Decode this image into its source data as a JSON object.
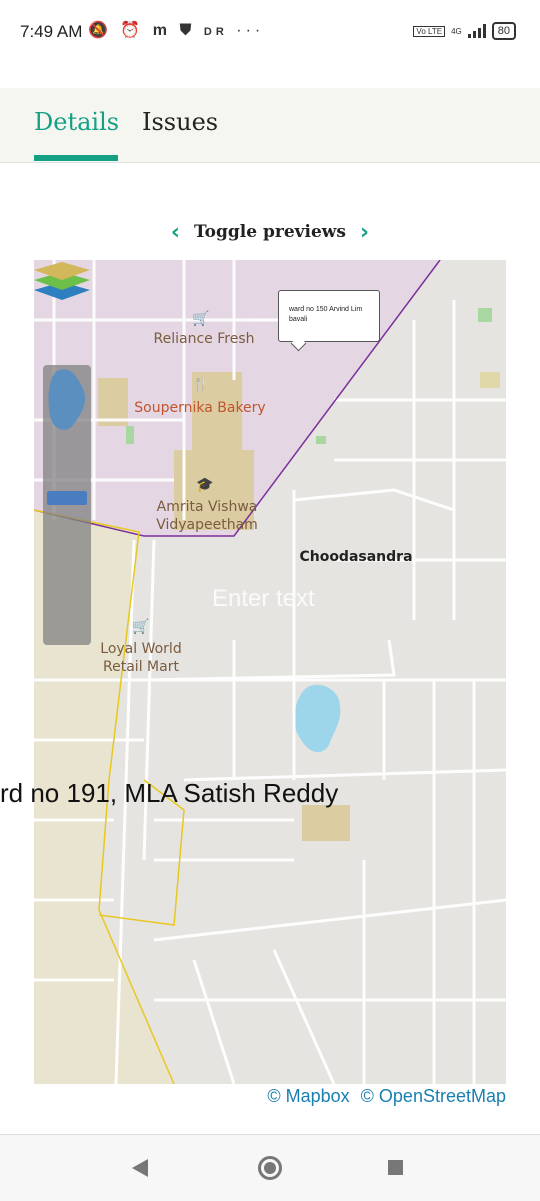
{
  "status_bar": {
    "time": "7:49 AM",
    "icons": [
      "bell-off-icon",
      "alarm-icon",
      "m-app-icon",
      "shield-icon",
      "dr-icon",
      "more-icon"
    ],
    "network": "4G",
    "battery": "80"
  },
  "tabs": [
    {
      "label": "Details",
      "active": true
    },
    {
      "label": "Issues",
      "active": false
    }
  ],
  "toggle": {
    "label": "Toggle previews"
  },
  "map": {
    "labels": {
      "reliance": "Reliance Fresh",
      "soupernika": "Soupernika Bakery",
      "amrita": "Amrita Vishwa Vidyapeetham",
      "choodasandra": "Choodasandra",
      "loyal": "Loyal World Retail Mart"
    },
    "popup_text": "ward no 150 Arvind Lim bavali",
    "enter_text": "Enter text",
    "ward_label": "rd no 191, MLA Satish Reddy",
    "attribution": [
      "© Mapbox",
      "© OpenStreetMap"
    ]
  },
  "colors": {
    "accent": "#13a085",
    "link": "#1a7fb0",
    "ward_purple": "#7a2f9b",
    "ward_yellow": "#e8c820"
  },
  "nav": [
    "back",
    "home",
    "recents"
  ]
}
